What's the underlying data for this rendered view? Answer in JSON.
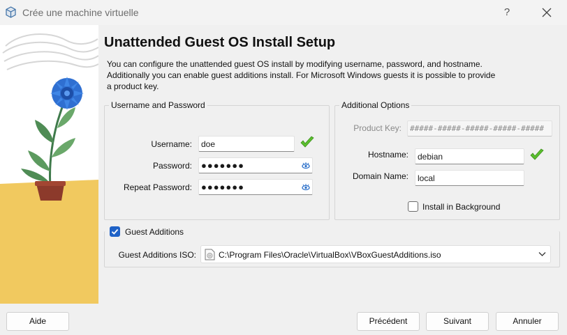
{
  "window": {
    "title": "Crée une machine virtuelle",
    "help_label": "?",
    "app_icon": "virtualbox-icon",
    "close_icon": "close-icon"
  },
  "page": {
    "heading": "Unattended Guest OS Install Setup",
    "description": "You can configure the unattended guest OS install by modifying username, password, and hostname. Additionally you can enable guest additions install. For Microsoft Windows guests it is possible to provide a product key."
  },
  "credentials": {
    "group_title": "Username and Password",
    "username_label": "Username:",
    "username_value": "doe",
    "password_label": "Password:",
    "password_value": "●●●●●●●",
    "repeat_label": "Repeat Password:",
    "repeat_value": "●●●●●●●"
  },
  "additional": {
    "group_title": "Additional Options",
    "product_key_label": "Product Key:",
    "product_key_value": "#####-#####-#####-#####-#####",
    "hostname_label": "Hostname:",
    "hostname_value": "debian",
    "domain_label": "Domain Name:",
    "domain_value": "local",
    "background_label": "Install in Background",
    "background_checked": false
  },
  "guest_additions": {
    "label": "Guest Additions",
    "checked": true,
    "iso_label": "Guest Additions ISO:",
    "iso_value": "C:\\Program Files\\Oracle\\VirtualBox\\VBoxGuestAdditions.iso"
  },
  "buttons": {
    "help": "Aide",
    "back": "Précédent",
    "next": "Suivant",
    "cancel": "Annuler"
  },
  "colors": {
    "accent": "#1f62c7",
    "valid_check": "#5bbf2e",
    "art_yellow": "#f1c95f"
  }
}
